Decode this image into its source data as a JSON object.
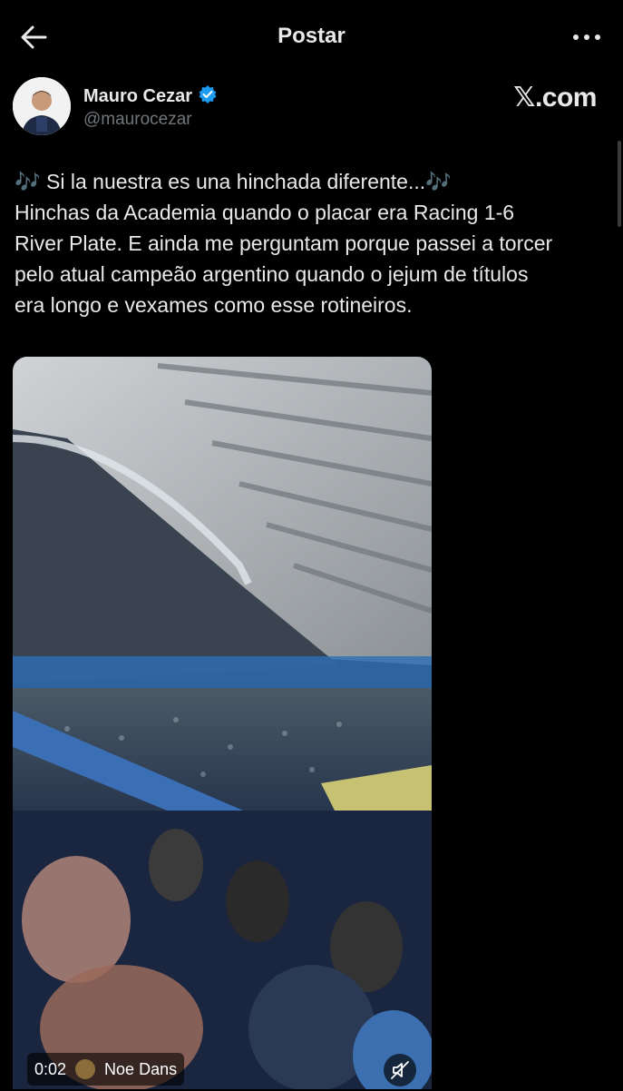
{
  "topbar": {
    "title": "Postar"
  },
  "author": {
    "name": "Mauro Cezar",
    "handle": "@maurocezar",
    "verified_color": "#1d9bf0"
  },
  "brand": "𝕏.com",
  "post": {
    "lines": [
      "🎶 Si la nuestra es una hinchada diferente...🎶",
      "Hinchas da Academia quando o placar era Racing  1-6",
      "River Plate. E ainda me perguntam porque passei a torcer",
      "pelo atual campeão argentino quando o jejum de títulos",
      "era longo e vexames como esse rotineiros."
    ]
  },
  "video": {
    "time": "0:02",
    "audio_label": "Noe Dans"
  },
  "colors": {
    "background": "#000000",
    "text": "#e7e9ea",
    "muted": "#71767b"
  }
}
